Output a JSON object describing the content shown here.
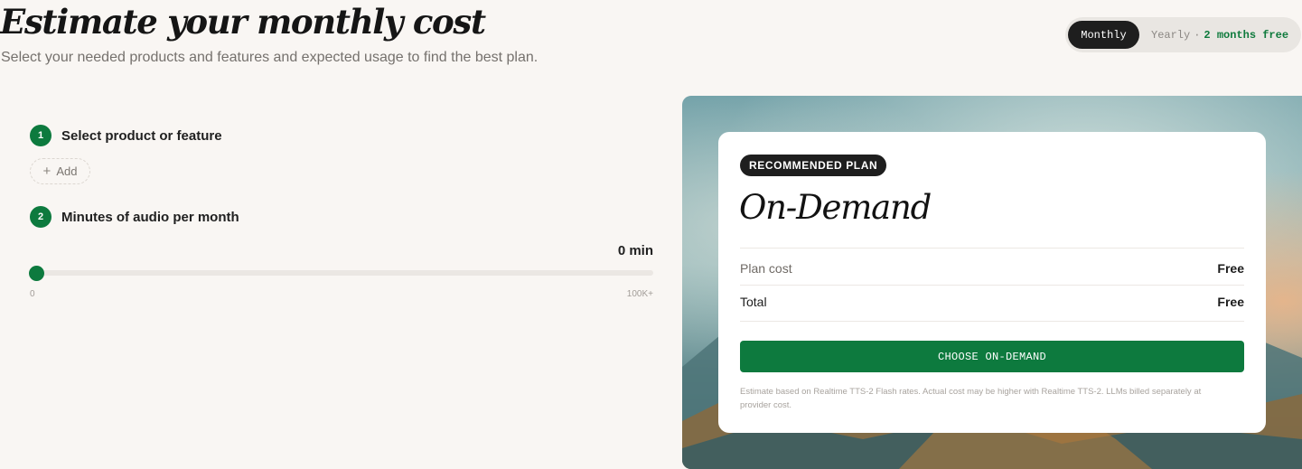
{
  "header": {
    "title": "Estimate your monthly cost",
    "subtitle": "Select your needed products and features and expected usage to find the best plan."
  },
  "billing_toggle": {
    "monthly_label": "Monthly",
    "yearly_label": "Yearly",
    "separator": "·",
    "yearly_promo": "2 months free",
    "selected": "Monthly"
  },
  "steps": [
    {
      "number": "1",
      "label": "Select product or feature"
    },
    {
      "number": "2",
      "label": "Minutes of audio per month"
    }
  ],
  "add_button": {
    "icon": "plus-icon",
    "label": "Add"
  },
  "usage_slider": {
    "value_display": "0 min",
    "value": 0,
    "min_label": "0",
    "max_label": "100K+"
  },
  "plan_card": {
    "badge": "RECOMMENDED PLAN",
    "plan_name": "On-Demand",
    "rows": [
      {
        "label": "Plan cost",
        "value": "Free"
      },
      {
        "label": "Total",
        "value": "Free"
      }
    ],
    "cta_label": "CHOOSE ON-DEMAND",
    "disclaimer": "Estimate based on Realtime TTS-2 Flash rates. Actual cost may be higher with Realtime TTS-2. LLMs billed separately at provider cost."
  },
  "colors": {
    "accent_green": "#0d7a3e",
    "dark": "#1e1e1e",
    "background": "#f9f6f3"
  }
}
